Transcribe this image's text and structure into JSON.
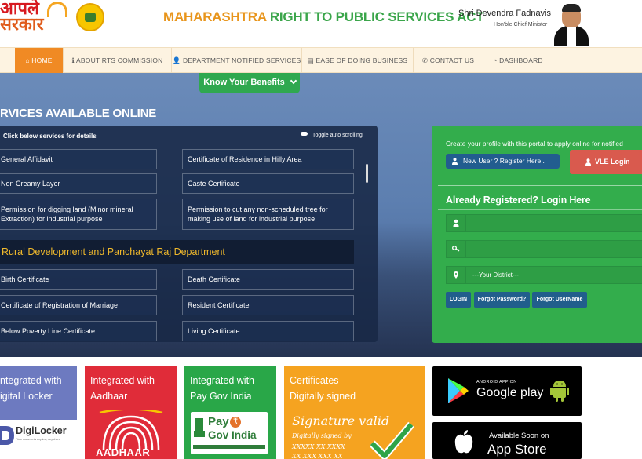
{
  "header": {
    "logo_line1": "आपले",
    "logo_line2": "सरकार",
    "title_part1": "MAHARASHTRA",
    "title_part2": "RIGHT TO PUBLIC SERVICES ACT",
    "cm_name": "Shri Devendra Fadnavis",
    "cm_title": "Hon'ble Chief Minister"
  },
  "nav": {
    "items": [
      {
        "label": "HOME",
        "icon": "home-icon"
      },
      {
        "label": "ABOUT RTS COMMISSION",
        "icon": "info-icon"
      },
      {
        "label": "DEPARTMENT NOTIFIED SERVICES",
        "icon": "user-icon"
      },
      {
        "label": "EASE OF DOING BUSINESS",
        "icon": "briefcase-icon"
      },
      {
        "label": "CONTACT US",
        "icon": "phone-icon"
      },
      {
        "label": "DASHBOARD",
        "icon": "dashboard-icon"
      }
    ]
  },
  "hero": {
    "benefits_label": "Know Your Benefits",
    "services_heading": "RVICES AVAILABLE ONLINE"
  },
  "services": {
    "header": "Click below services for details",
    "toggle_label": "Toggle auto scrolling",
    "rows": [
      [
        "General Affidavit",
        "Certificate of Residence in Hilly Area"
      ],
      [
        "Non Creamy Layer",
        "Caste Certificate"
      ],
      [
        "Permission for digging land (Minor mineral Extraction) for industrial purpose",
        "Permission to cut any non-scheduled tree for making use of land for industrial purpose"
      ]
    ],
    "department": "Rural Development and Panchayat Raj Department",
    "rows2": [
      [
        "Birth Certificate",
        "Death Certificate"
      ],
      [
        "Certificate of Registration of Marriage",
        "Resident Certificate"
      ],
      [
        "Below Poverty Line Certificate",
        "Living Certificate"
      ]
    ]
  },
  "login": {
    "create_profile": "Create your profile with this portal to apply online for notified",
    "new_user": "New User ? Register Here..",
    "vle_login": "VLE Login",
    "heading": "Already Registered? Login Here",
    "district_placeholder": "---Your District---",
    "login_btn": "LOGIN",
    "forgot_password": "Forgot Password?",
    "forgot_username": "Forgot UserName"
  },
  "tiles": {
    "digilocker": {
      "line1": "ntegrated with",
      "line2": "igital Locker",
      "logo": "DigiLocker",
      "tag": "Your documents anytime, anywhere"
    },
    "aadhaar": {
      "line1": "Integrated with",
      "line2": "Aadhaar",
      "logo": "AADHAAR"
    },
    "paygov": {
      "line1": "Integrated with",
      "line2": "Pay Gov India",
      "logo1": "Pay",
      "logo2": "Gov India"
    },
    "digisign": {
      "line1": "Certificates",
      "line2": "Digitally signed",
      "sig1": "Signature valid",
      "sig2": "Digitally signed by",
      "sig3": "XXXXX XX XXXX",
      "sig4": "XX XXX XXX XX"
    }
  },
  "stores": {
    "google_small": "ANDROID APP ON",
    "google_big": "Google play",
    "apple_small": "Available Soon on",
    "apple_big": "App Store"
  },
  "colors": {
    "accent_orange": "#f08a24",
    "green": "#33ad4c",
    "navy_panel": "#182846",
    "dept_text": "#f0b92c"
  }
}
